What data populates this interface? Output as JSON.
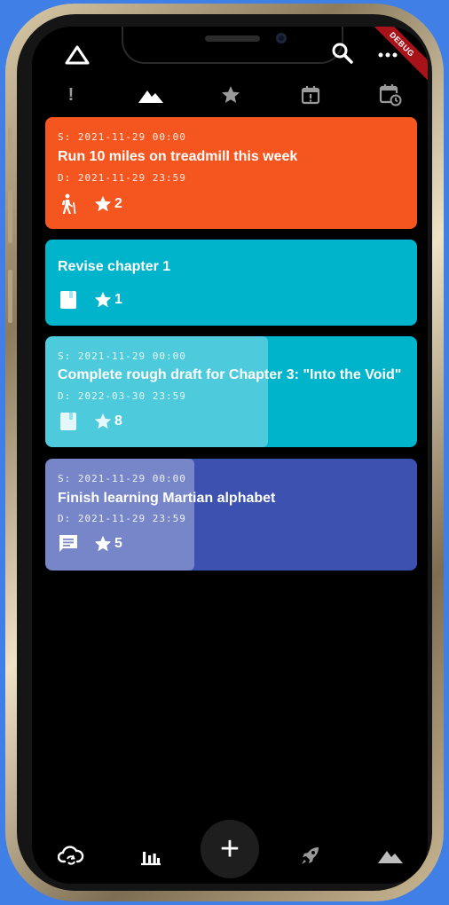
{
  "debug_banner": "DEBUG",
  "filter_tabs": [
    {
      "icon": "exclamation-icon",
      "label": "!"
    },
    {
      "icon": "mountain-icon",
      "selected": true
    },
    {
      "icon": "star-icon"
    },
    {
      "icon": "calendar-alert-icon"
    },
    {
      "icon": "calendar-clock-icon"
    }
  ],
  "goals": [
    {
      "start": "S: 2021-11-29 00:00",
      "title": "Run 10 miles on treadmill this week",
      "due": "D: 2021-11-29 23:59",
      "category_icon": "hiking-icon",
      "stars": "2",
      "color": "#f5561f",
      "progress": 0
    },
    {
      "title": "Revise chapter 1",
      "category_icon": "book-icon",
      "stars": "1",
      "color": "#00b4cc",
      "progress": 0
    },
    {
      "start": "S: 2021-11-29 00:00",
      "title": "Complete rough draft for Chapter 3: \"Into the Void\"",
      "due": "D: 2022-03-30 23:59",
      "category_icon": "book-icon",
      "stars": "8",
      "color": "#00b4cc",
      "progress": 0.6
    },
    {
      "start": "S: 2021-11-29 00:00",
      "title": "Finish learning Martian alphabet",
      "due": "D: 2021-11-29 23:59",
      "category_icon": "chat-icon",
      "stars": "5",
      "color": "#3d52b0",
      "progress": 0.4
    }
  ],
  "bottom_nav": [
    {
      "icon": "cloud-sync-icon"
    },
    {
      "icon": "bar-chart-icon"
    },
    {
      "icon": "add-icon",
      "label": "+"
    },
    {
      "icon": "rocket-icon"
    },
    {
      "icon": "mountain-icon"
    }
  ]
}
